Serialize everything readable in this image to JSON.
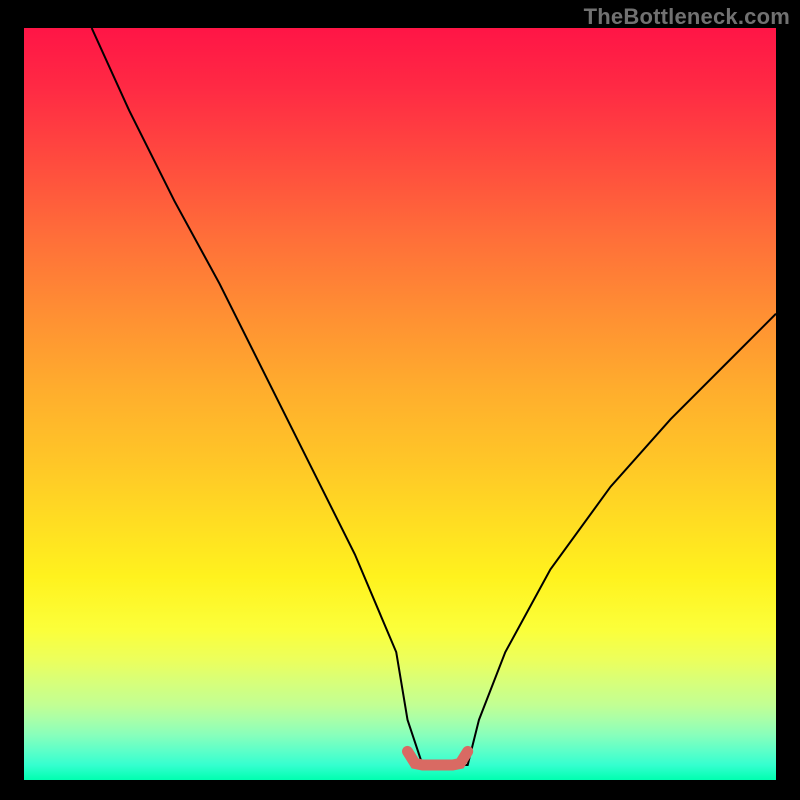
{
  "watermark": "TheBottleneck.com",
  "chart_data": {
    "type": "line",
    "title": "",
    "xlabel": "",
    "ylabel": "",
    "xlim": [
      0,
      100
    ],
    "ylim": [
      0,
      100
    ],
    "series": [
      {
        "name": "bottleneck-curve",
        "x": [
          9,
          14,
          20,
          26,
          32,
          38,
          44,
          49.5,
          51,
          53,
          57,
          59,
          60.5,
          64,
          70,
          78,
          86,
          94,
          100
        ],
        "y": [
          100,
          89,
          77,
          66,
          54,
          42,
          30,
          17,
          8,
          2,
          2,
          2,
          8,
          17,
          28,
          39,
          48,
          56,
          62
        ]
      },
      {
        "name": "flat-bottom-marker",
        "x": [
          51,
          52,
          53,
          54,
          55,
          56,
          57,
          58,
          59
        ],
        "y": [
          3.8,
          2.2,
          2,
          2,
          2,
          2,
          2,
          2.2,
          3.8
        ]
      }
    ],
    "marker_color": "#d96a63",
    "curve_color": "#000000"
  }
}
